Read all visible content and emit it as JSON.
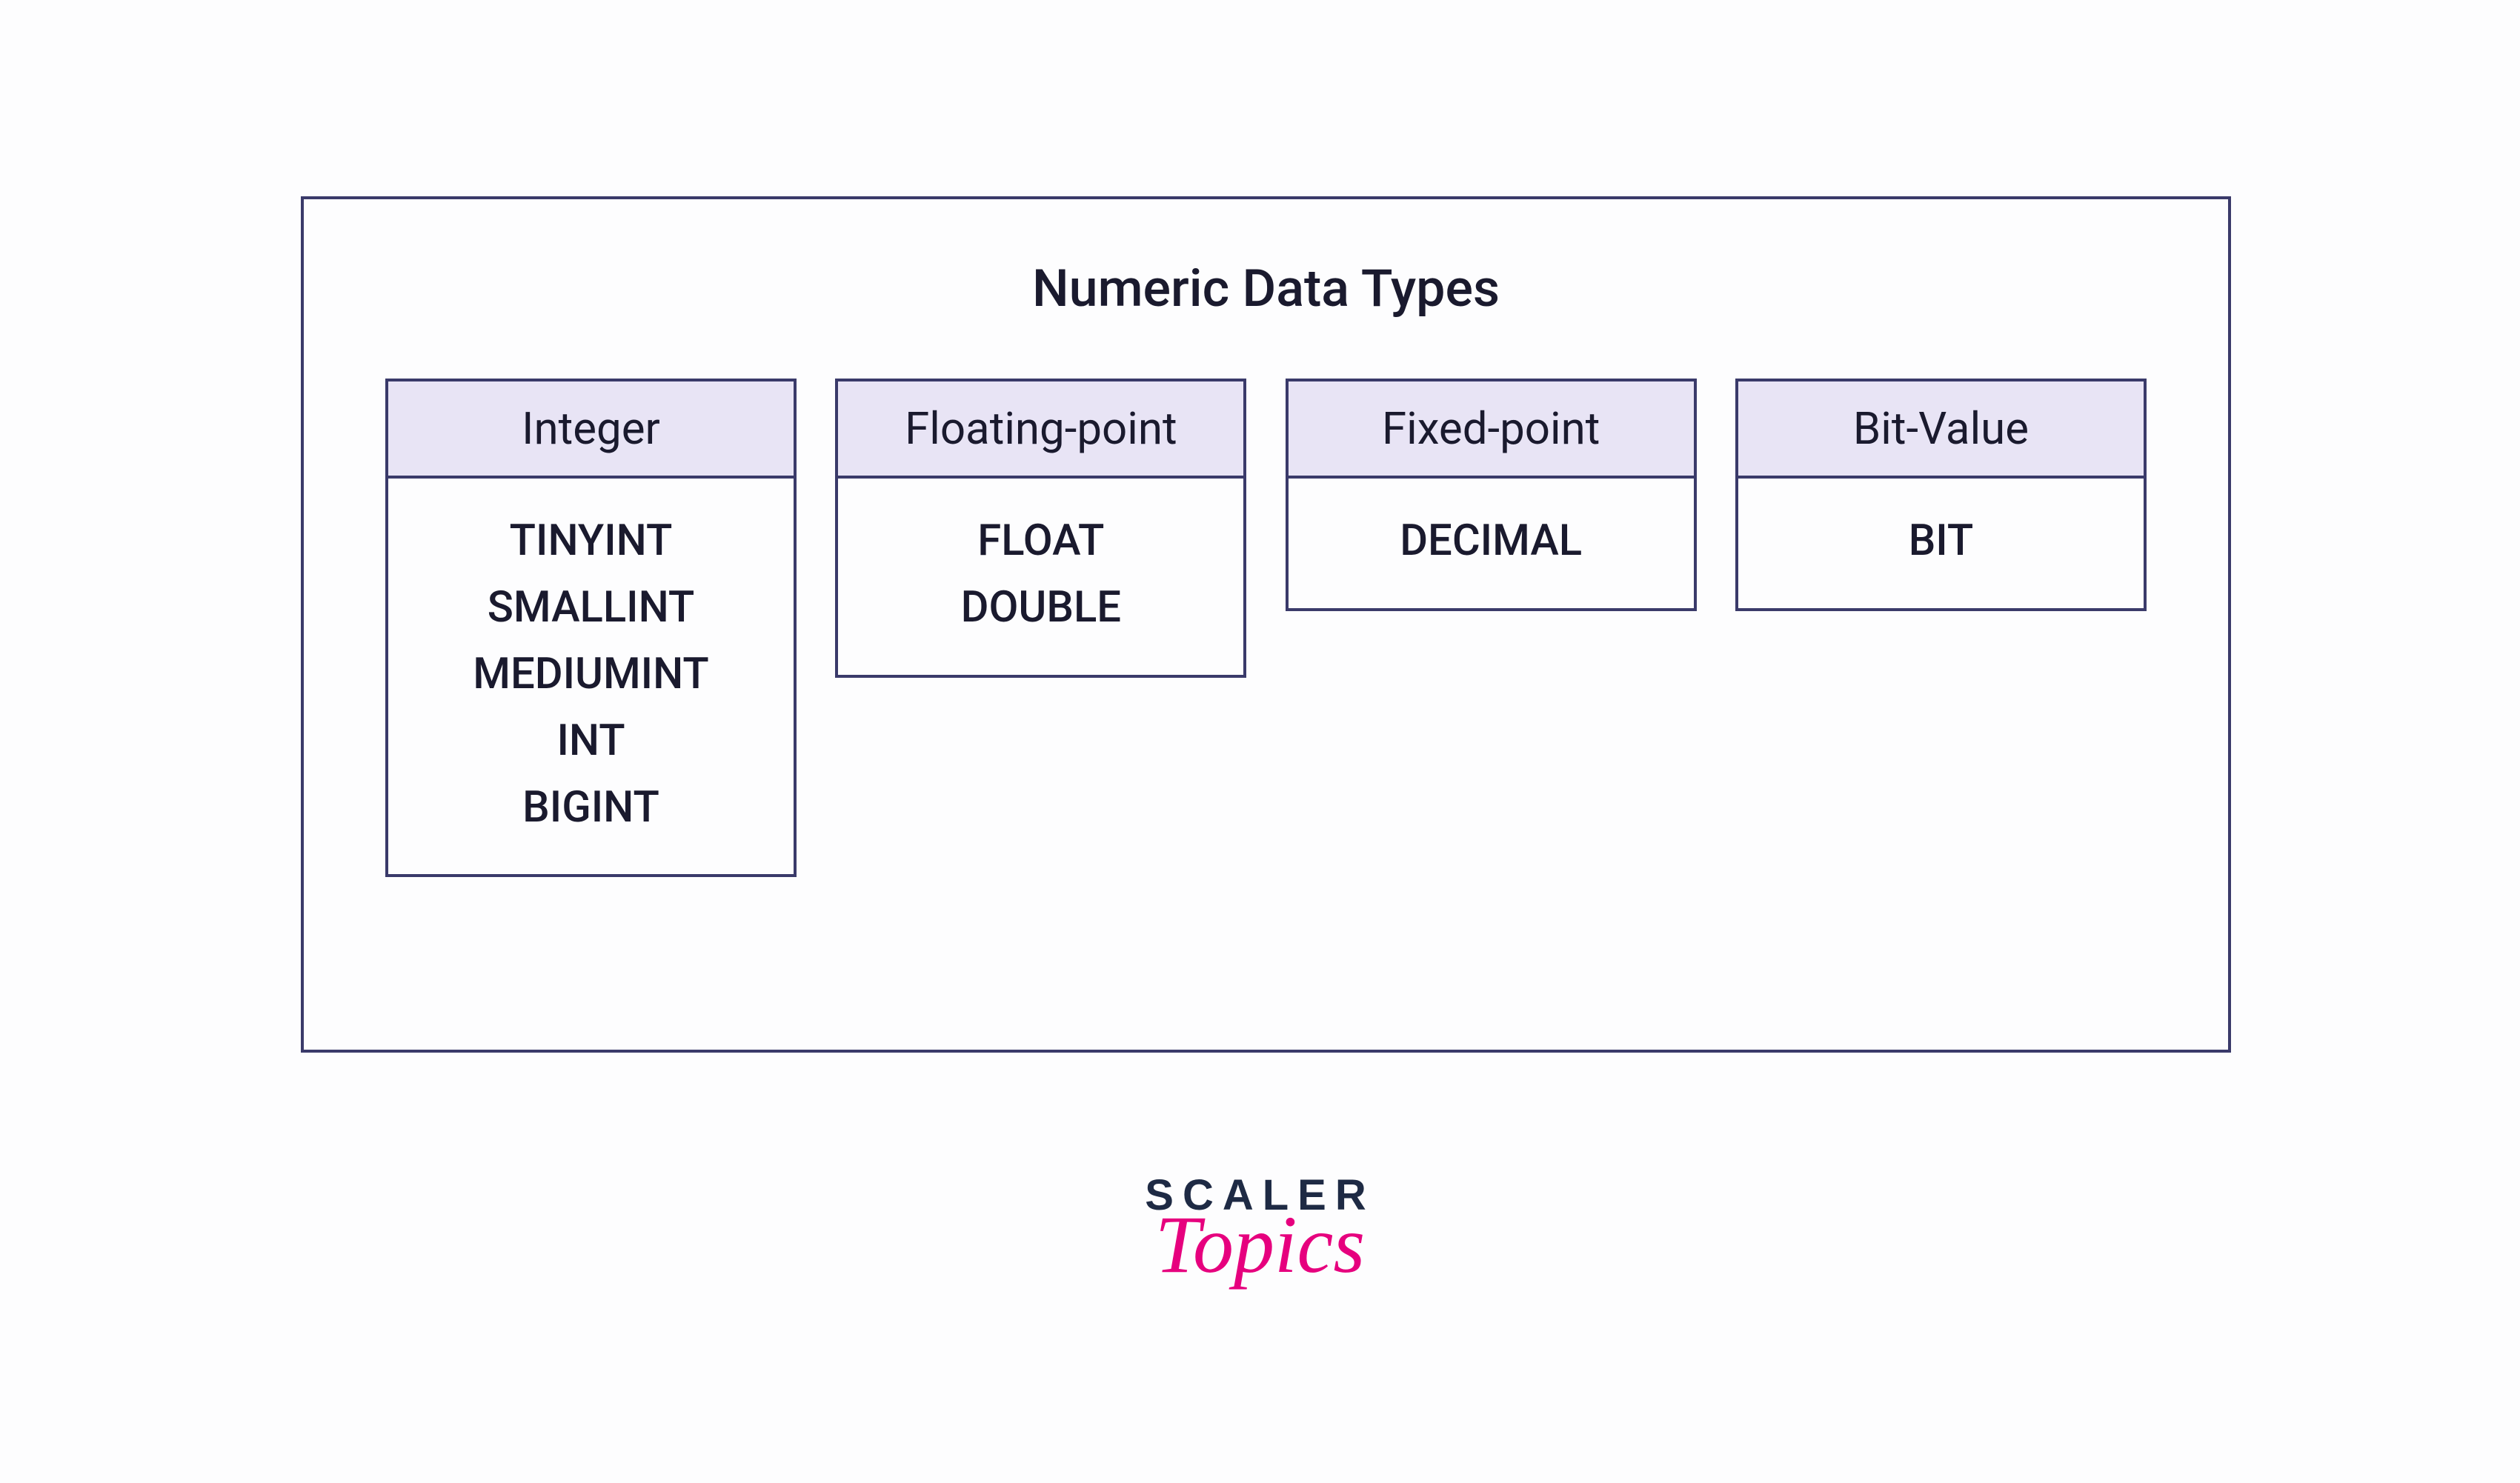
{
  "diagram": {
    "title": "Numeric Data Types",
    "columns": [
      {
        "header": "Integer",
        "items": [
          "TINYINT",
          "SMALLINT",
          "MEDIUMINT",
          "INT",
          "BIGINT"
        ]
      },
      {
        "header": "Floating-point",
        "items": [
          "FLOAT",
          "DOUBLE"
        ]
      },
      {
        "header": "Fixed-point",
        "items": [
          "DECIMAL"
        ]
      },
      {
        "header": "Bit-Value",
        "items": [
          "BIT"
        ]
      }
    ]
  },
  "branding": {
    "line1": "SCALER",
    "line2": "Topics"
  }
}
